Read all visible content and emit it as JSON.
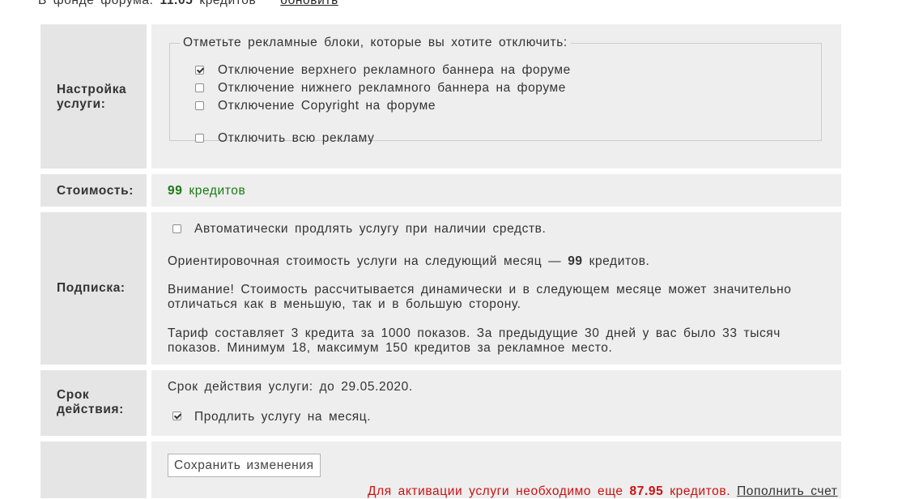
{
  "balance": {
    "text": "В фонде форума:",
    "amount": "11.05",
    "unit": "кредитов",
    "refresh_link": "обновить"
  },
  "settings": {
    "label_line1": "Настройка",
    "label_line2": "услуги:",
    "legend": "Отметьте рекламные блоки, которые вы хотите отключить:",
    "options": [
      {
        "label": "Отключение верхнего рекламного баннера на форуме",
        "checked": true
      },
      {
        "label": "Отключение нижнего рекламного баннера на форуме",
        "checked": false
      },
      {
        "label": "Отключение Copyright на форуме",
        "checked": false
      }
    ],
    "disable_all": {
      "label": "Отключить всю рекламу",
      "checked": false
    }
  },
  "cost": {
    "label": "Стоимость:",
    "value": "99",
    "unit": "кредитов"
  },
  "subscription": {
    "label": "Подписка:",
    "auto_renew": {
      "label": "Автоматически продлять услугу при наличии средств.",
      "checked": false
    },
    "estimate_prefix": "Ориентировочная стоимость услуги на следующий месяц —",
    "estimate_value": "99",
    "estimate_suffix": "кредитов.",
    "warning_bold": "Внимание!",
    "warning_line1": "Стоимость рассчитывается динамически и в следующем месяце может значительно",
    "warning_line2": "отличаться как в меньшую, так и в большую сторону.",
    "tariff_line1": "Тариф составляет 3 кредита за 1000 показов. За предыдущие 30 дней у вас было 33 тысяч",
    "tariff_line2": "показов. Минимум 18, максимум 150 кредитов за рекламное место."
  },
  "term": {
    "label_line1": "Срок",
    "label_line2": "действия:",
    "valid_until": "Срок действия услуги: до 29.05.2020.",
    "extend": {
      "label": "Продлить услугу на месяц.",
      "checked": true
    }
  },
  "footer": {
    "save_button": "Сохранить изменения",
    "warning_prefix": "Для активации услуги необходимо еще",
    "warning_amount": "87.95",
    "warning_unit": "кредитов.",
    "pay_link": "Пополнить счет"
  },
  "colors": {
    "label_bg": "#e5e5e5",
    "cell_bg": "#eeeeee",
    "cost_green": "#1a7a12",
    "warning_red": "#cc1111"
  }
}
